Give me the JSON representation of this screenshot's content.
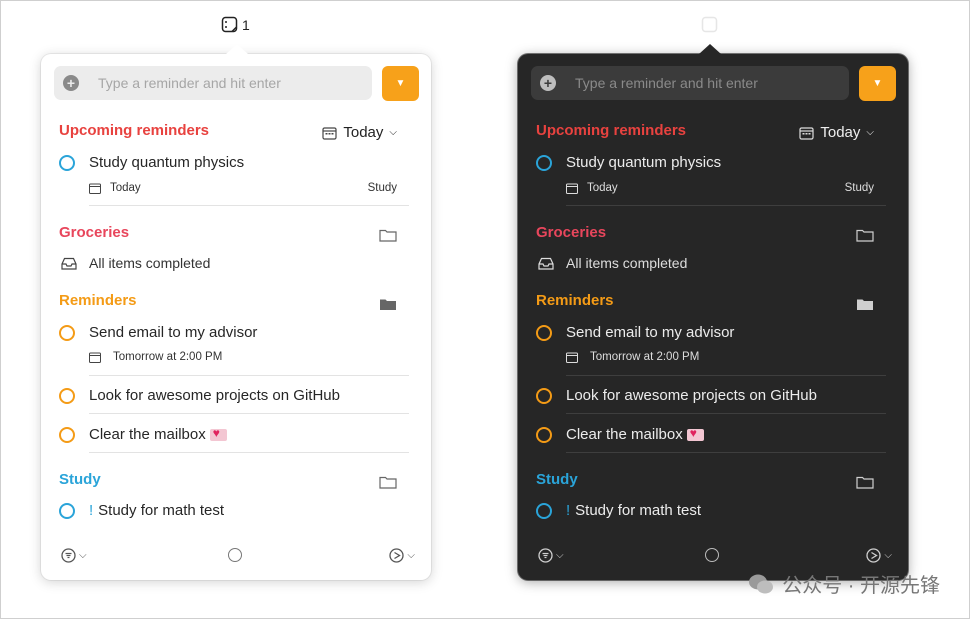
{
  "menubar": {
    "badge_count": "1"
  },
  "input": {
    "placeholder": "Type a reminder and hit enter"
  },
  "today_filter": {
    "label": "Today"
  },
  "sections": {
    "upcoming": {
      "title": "Upcoming reminders",
      "color": "#e8423f",
      "items": [
        {
          "text": "Study quantum physics",
          "date": "Today",
          "list": "Study"
        }
      ]
    },
    "groceries": {
      "title": "Groceries",
      "color": "#e8465c",
      "status": "All items completed"
    },
    "reminders": {
      "title": "Reminders",
      "color": "#f49b16",
      "items": [
        {
          "text": "Send email to my advisor",
          "date": "Tomorrow at 2:00 PM"
        },
        {
          "text": "Look for awesome projects on GitHub"
        },
        {
          "text": "Clear the mailbox"
        }
      ]
    },
    "study": {
      "title": "Study",
      "color": "#2aa4d9",
      "items": [
        {
          "priority": "!",
          "text": "Study for math test"
        }
      ]
    }
  },
  "accent": {
    "button": "#f7a11a",
    "study_circle": "#2aa4d9",
    "reminder_circle": "#f49b16"
  },
  "watermark": {
    "text": "公众号 · 开源先锋"
  }
}
